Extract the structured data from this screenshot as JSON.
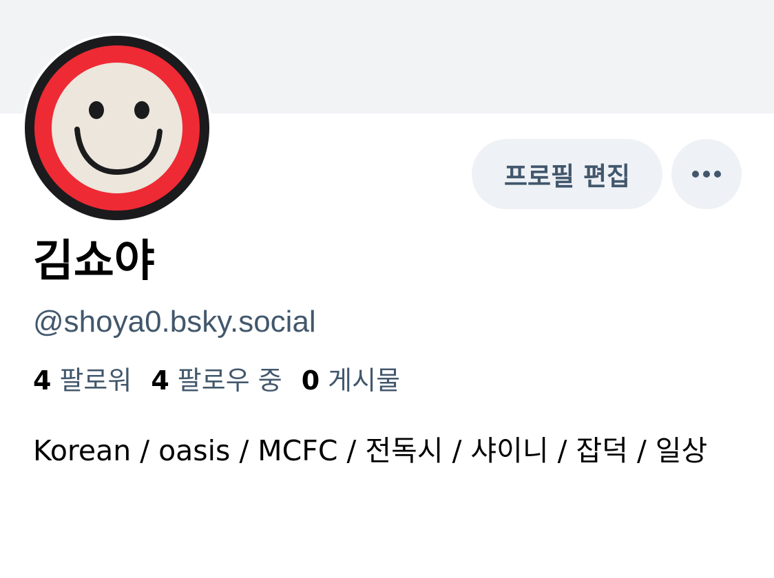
{
  "profile": {
    "display_name": "김쇼야",
    "handle": "@shoya0.bsky.social",
    "bio": "Korean / oasis / MCFC / 전독시 / 샤이니 / 잡덕 / 일상"
  },
  "actions": {
    "edit_profile_label": "프로필 편집",
    "more_icon": "ellipsis-icon"
  },
  "stats": {
    "followers": {
      "count": "4",
      "label": "팔로워"
    },
    "following": {
      "count": "4",
      "label": "팔로우 중"
    },
    "posts": {
      "count": "0",
      "label": "게시물"
    }
  },
  "colors": {
    "banner": "#f1f3f5",
    "button_bg": "#eef1f5",
    "secondary_text": "#42576c",
    "primary_text": "#000000",
    "avatar_ring": "#ee2a35",
    "avatar_face": "#ece6dc"
  }
}
